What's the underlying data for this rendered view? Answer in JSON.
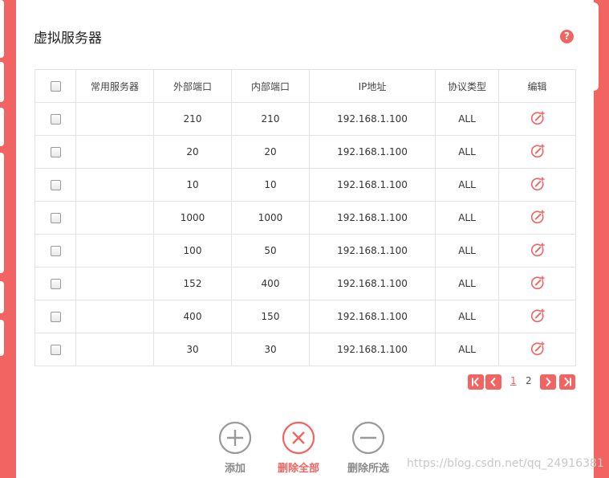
{
  "page": {
    "title": "虚拟服务器",
    "help_glyph": "?"
  },
  "colors": {
    "accent": "#f26461",
    "muted_icon": "#9a9a9a"
  },
  "table": {
    "headers": [
      "",
      "常用服务器",
      "外部端口",
      "内部端口",
      "IP地址",
      "协议类型",
      "编辑"
    ],
    "rows": [
      {
        "service": "",
        "external_port": "210",
        "internal_port": "210",
        "ip": "192.168.1.100",
        "protocol": "ALL"
      },
      {
        "service": "",
        "external_port": "20",
        "internal_port": "20",
        "ip": "192.168.1.100",
        "protocol": "ALL"
      },
      {
        "service": "",
        "external_port": "10",
        "internal_port": "10",
        "ip": "192.168.1.100",
        "protocol": "ALL"
      },
      {
        "service": "",
        "external_port": "1000",
        "internal_port": "1000",
        "ip": "192.168.1.100",
        "protocol": "ALL"
      },
      {
        "service": "",
        "external_port": "100",
        "internal_port": "50",
        "ip": "192.168.1.100",
        "protocol": "ALL"
      },
      {
        "service": "",
        "external_port": "152",
        "internal_port": "400",
        "ip": "192.168.1.100",
        "protocol": "ALL"
      },
      {
        "service": "",
        "external_port": "400",
        "internal_port": "150",
        "ip": "192.168.1.100",
        "protocol": "ALL"
      },
      {
        "service": "",
        "external_port": "30",
        "internal_port": "30",
        "ip": "192.168.1.100",
        "protocol": "ALL"
      }
    ]
  },
  "pagination": {
    "pages": [
      "1",
      "2"
    ],
    "current": "1"
  },
  "actions": {
    "add": "添加",
    "delete_all": "删除全部",
    "delete_selected": "删除所选"
  },
  "watermark": "https://blog.csdn.net/qq_24916381"
}
